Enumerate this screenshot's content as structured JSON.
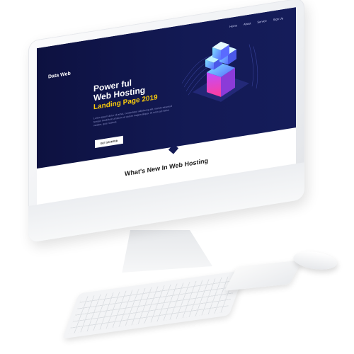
{
  "site": {
    "logo": "Data Web",
    "nav": [
      "Home",
      "About",
      "Service",
      "Sign Up"
    ],
    "hero": {
      "title_line1": "Power ful",
      "title_line2": "Web Hosting",
      "title_line3": "Landing Page 2019",
      "description": "Lorem ipsum dolor sit amet, consectetur adipiscing elit, sed do eiusmod tempor incididunt ut labore et dolore magna aliqua. Ut enim ad minim veniam, quis nostrud.",
      "button_label": "GET STARTED"
    },
    "section_heading": "What's New In Web Hosting"
  },
  "colors": {
    "hero_bg": "#131a55",
    "accent_yellow": "#f6c90e",
    "device_white": "#f3f4f6"
  },
  "icons": {
    "hero_art": "server-stack-isometric-icon"
  }
}
